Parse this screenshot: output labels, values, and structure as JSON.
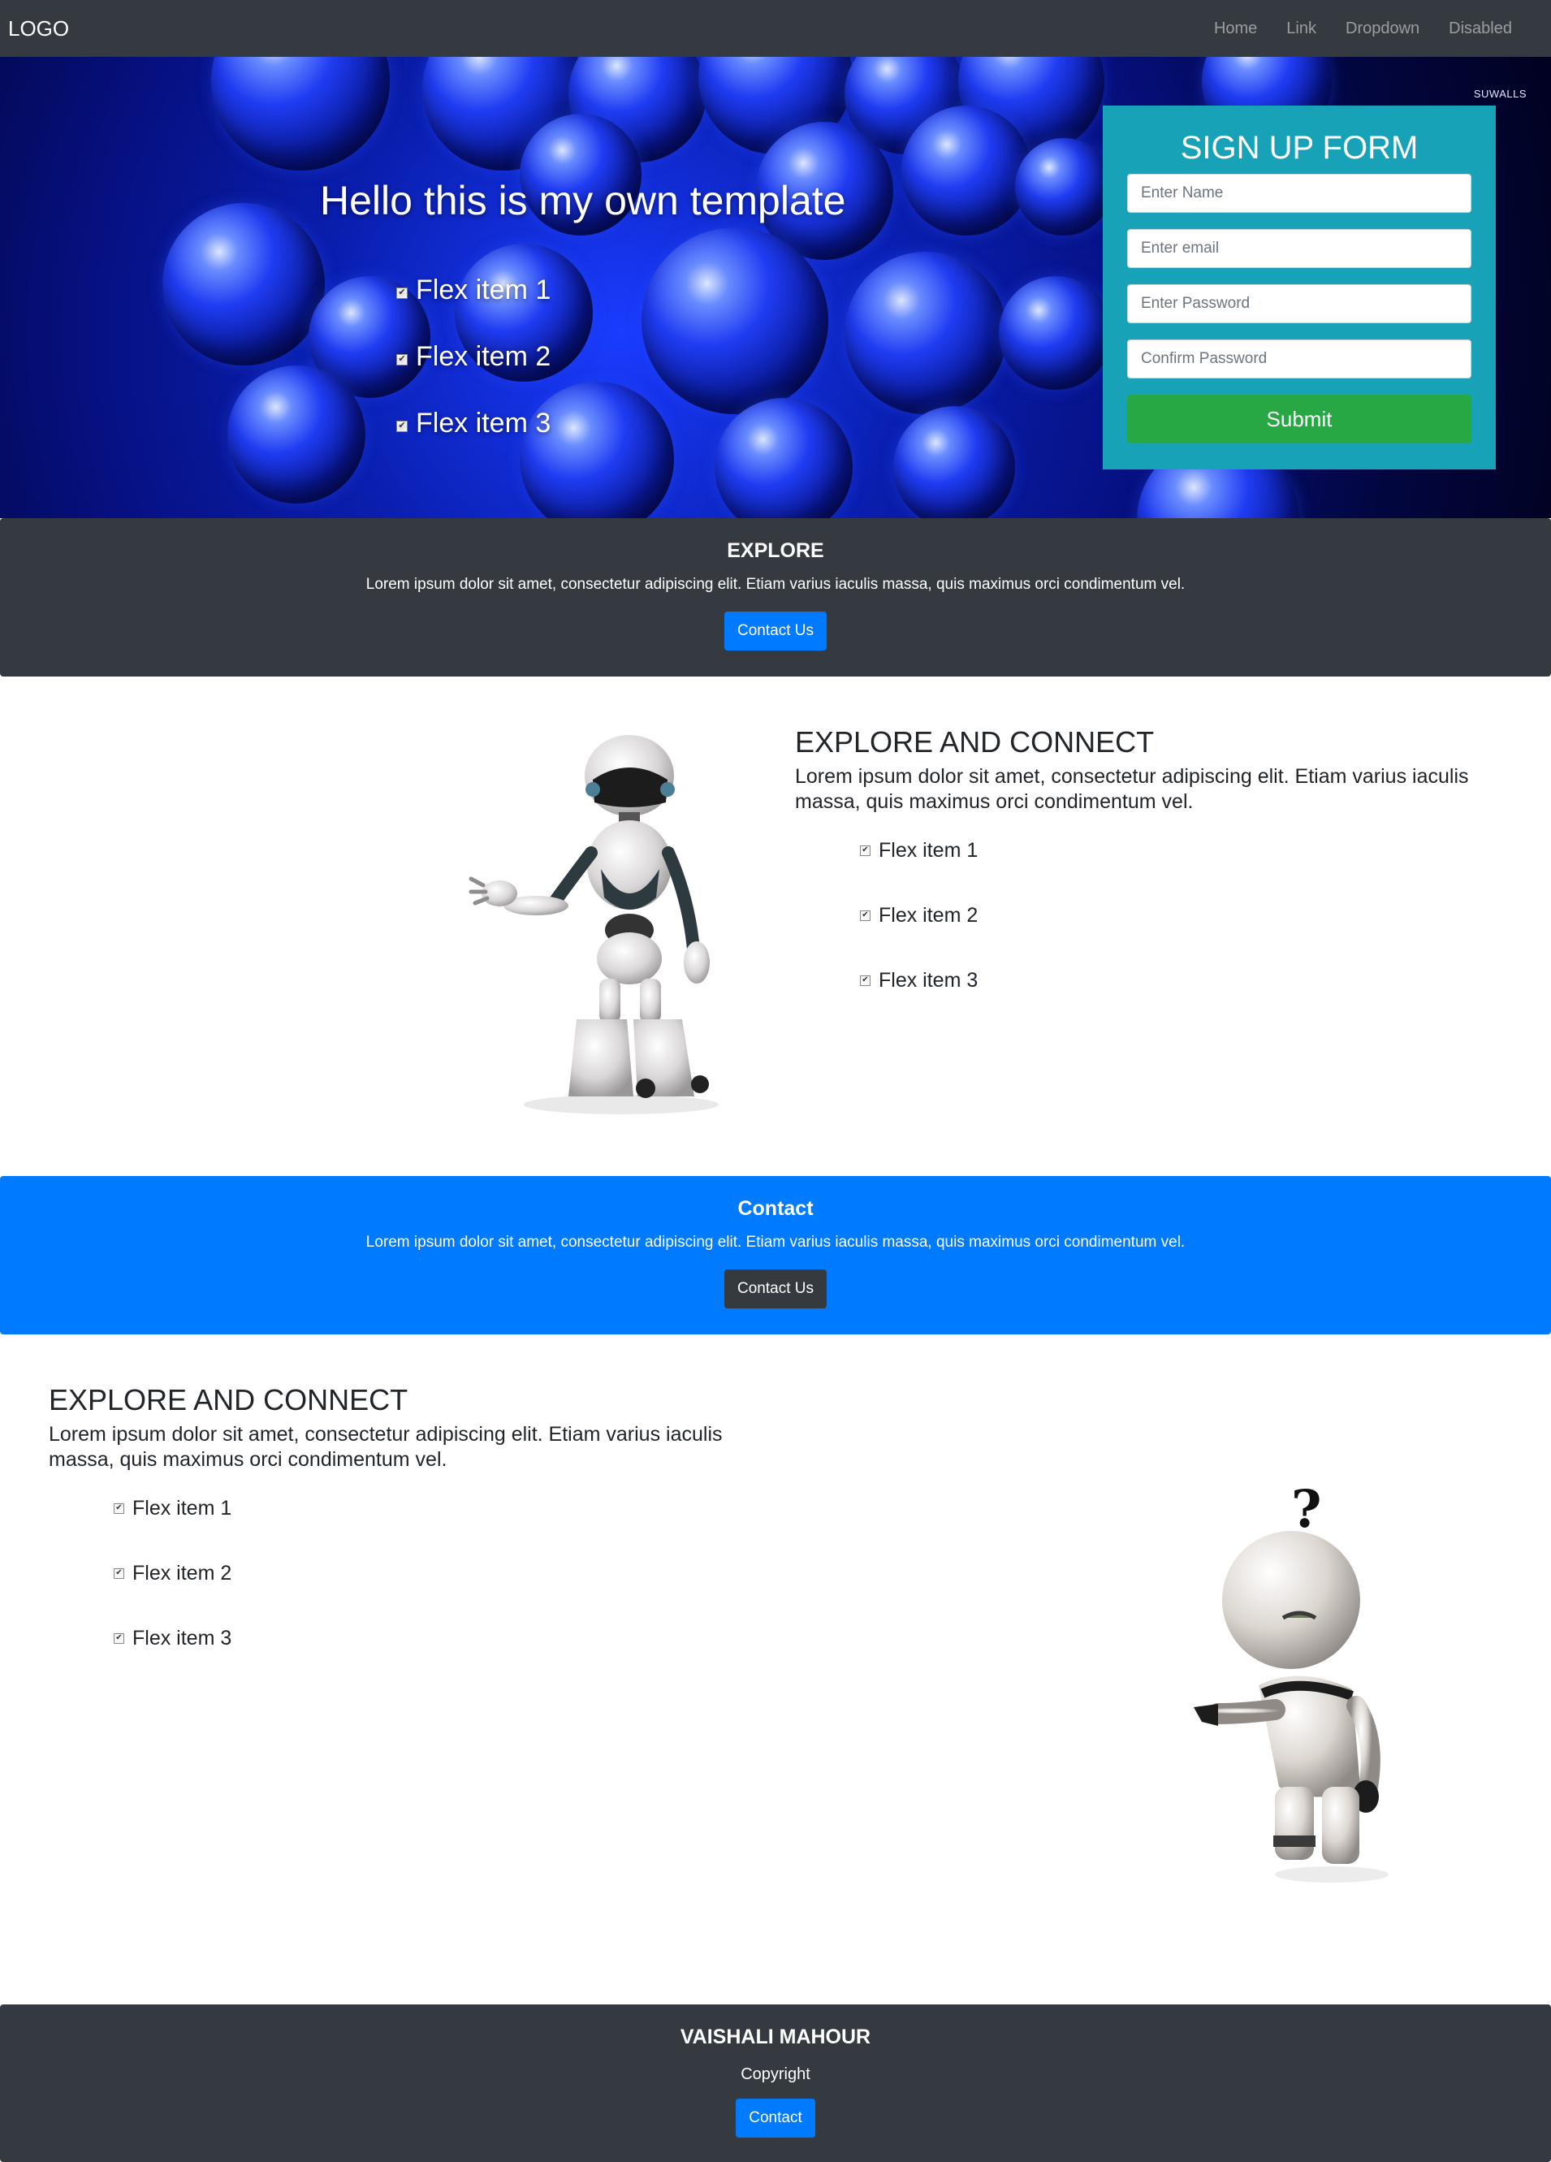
{
  "navbar": {
    "brand": "LOGO",
    "links": [
      "Home",
      "Link",
      "Dropdown",
      "Disabled"
    ]
  },
  "hero": {
    "title": "Hello this is my own template",
    "items": [
      "Flex item 1",
      "Flex item 2",
      "Flex item 3"
    ],
    "watermark": "SUWALLS",
    "colors": {
      "background": "#0a1fb0"
    }
  },
  "signup": {
    "title": "SIGN UP FORM",
    "fields": [
      {
        "placeholder": "Enter Name"
      },
      {
        "placeholder": "Enter email"
      },
      {
        "placeholder": "Enter Password"
      },
      {
        "placeholder": "Confirm Password"
      }
    ],
    "submit_label": "Submit",
    "colors": {
      "panel": "#17a2b8",
      "submit": "#28a745"
    }
  },
  "explore_band": {
    "title": "EXPLORE",
    "text": "Lorem ipsum dolor sit amet, consectetur adipiscing elit. Etiam varius iaculis massa, quis maximus orci condimentum vel.",
    "button_label": "Contact Us"
  },
  "feature1": {
    "title": "EXPLORE AND CONNECT",
    "text": "Lorem ipsum dolor sit amet, consectetur adipiscing elit. Etiam varius iaculis massa, quis maximus orci condimentum vel.",
    "items": [
      "Flex item 1",
      "Flex item 2",
      "Flex item 3"
    ]
  },
  "contact_band": {
    "title": "Contact",
    "text": "Lorem ipsum dolor sit amet, consectetur adipiscing elit. Etiam varius iaculis massa, quis maximus orci condimentum vel.",
    "button_label": "Contact Us"
  },
  "feature2": {
    "title": "EXPLORE AND CONNECT",
    "text": "Lorem ipsum dolor sit amet, consectetur adipiscing elit. Etiam varius iaculis massa, quis maximus orci condimentum vel.",
    "items": [
      "Flex item 1",
      "Flex item 2",
      "Flex item 3"
    ],
    "robot_symbol": "?"
  },
  "footer": {
    "name": "VAISHALI MAHOUR",
    "copyright": "Copyright",
    "button_label": "Contact"
  }
}
